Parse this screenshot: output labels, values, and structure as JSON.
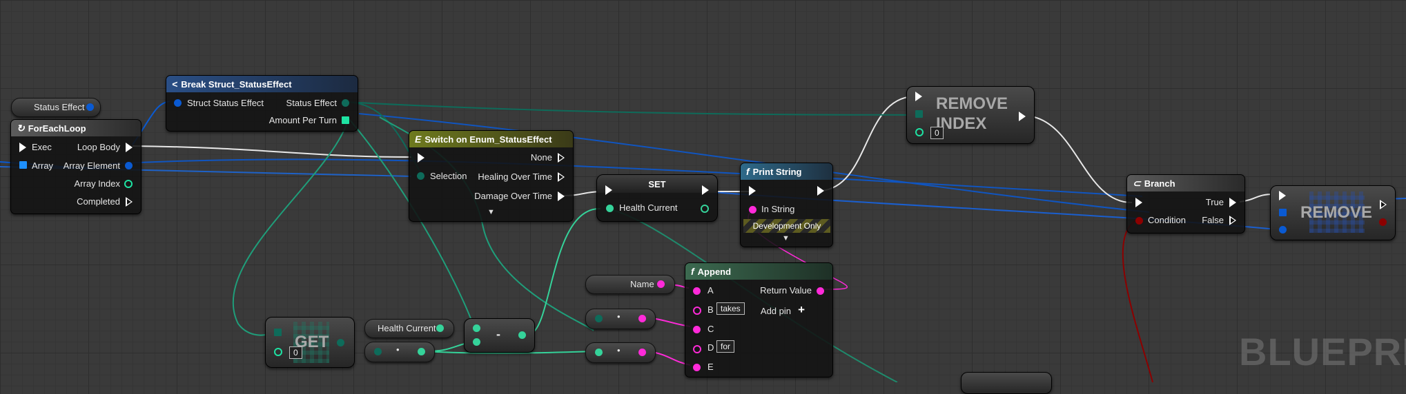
{
  "colors": {
    "exec": "#ffffff",
    "struct": "#0a5ad2",
    "enum": "#0e6b5a",
    "float": "#35d39a",
    "string": "#ff2ad9",
    "bool": "#8c0000",
    "int": "#1ee3a3",
    "array": "#1e90ff"
  },
  "nodes": {
    "status_effect_getter": {
      "label": "Status Effect"
    },
    "foreach": {
      "title": "ForEachLoop",
      "exec": "Exec",
      "array": "Array",
      "loop_body": "Loop Body",
      "array_element": "Array Element",
      "array_index": "Array Index",
      "completed": "Completed"
    },
    "break_struct": {
      "title": "Break Struct_StatusEffect",
      "input": "Struct Status Effect",
      "out_status": "Status Effect",
      "out_amount": "Amount Per Turn"
    },
    "switch": {
      "title": "Switch on Enum_StatusEffect",
      "selection": "Selection",
      "none": "None",
      "heal": "Healing Over Time",
      "damage": "Damage Over Time"
    },
    "set": {
      "title": "SET",
      "var": "Health Current"
    },
    "print": {
      "title": "Print String",
      "in_string": "In String",
      "dev": "Development Only"
    },
    "remove_index": {
      "title_line1": "REMOVE",
      "title_line2": "INDEX",
      "index_value": "0"
    },
    "branch": {
      "title": "Branch",
      "condition": "Condition",
      "true": "True",
      "false": "False"
    },
    "remove": {
      "title": "REMOVE"
    },
    "name_var": {
      "label": "Name"
    },
    "append": {
      "title": "Append",
      "a": "A",
      "b": "B",
      "b_value": "takes",
      "c": "C",
      "d": "D",
      "d_value": "for",
      "e": "E",
      "return": "Return Value",
      "add_pin": "Add pin"
    },
    "get": {
      "title": "GET",
      "index_value": "0"
    },
    "health_var": {
      "label": "Health Current"
    },
    "subtract": {
      "op": "-"
    }
  },
  "watermark": "BLUEPRINT"
}
